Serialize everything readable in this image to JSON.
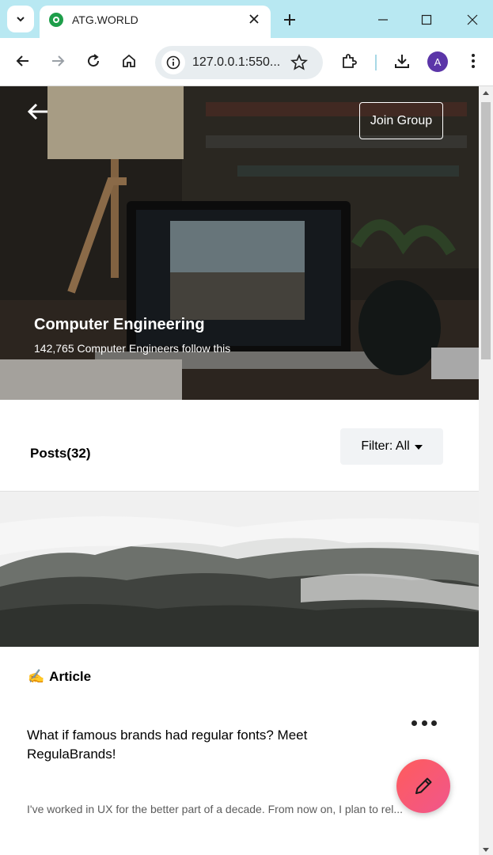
{
  "browser": {
    "tab_title": "ATG.WORLD",
    "url": "127.0.0.1:550...",
    "avatar_letter": "A"
  },
  "hero": {
    "join_label": "Join Group",
    "group_title": "Computer Engineering",
    "followers_text": "142,765 Computer Engineers follow this"
  },
  "posts": {
    "title": "Posts(32)",
    "filter_label": "Filter: All"
  },
  "post": {
    "type_emoji": "✍️",
    "type_label": "Article",
    "title": "What if famous brands had regular fonts? Meet RegulaBrands!",
    "excerpt": "I've worked in UX for the better part of a decade. From now on, I plan to rel..."
  },
  "colors": {
    "accent": "#f0568c",
    "tabstrip": "#b8e8f2"
  }
}
